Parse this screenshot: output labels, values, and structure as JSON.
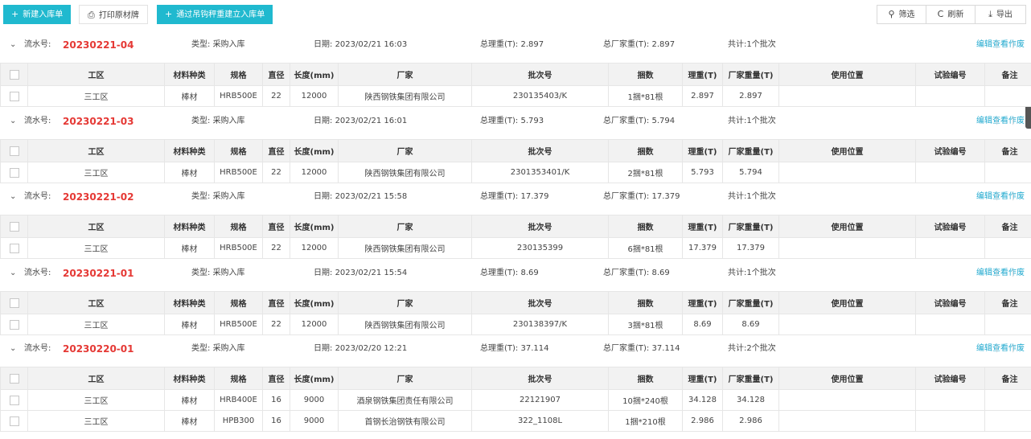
{
  "toolbar": {
    "new_label": "新建入库单",
    "print_label": "打印原材牌",
    "weigh_label": "通过吊钩秤重建立入库单",
    "filter_label": "筛选",
    "refresh_label": "刷新",
    "export_label": "导出"
  },
  "labels": {
    "flow": "流水号:",
    "type": "类型:",
    "date": "日期:",
    "theory_total": "总理重(T):",
    "factory_total": "总厂家重(T):",
    "count": "共计:",
    "edit": "编辑",
    "view": "查看",
    "void": "作废"
  },
  "columns": [
    "",
    "工区",
    "材料种类",
    "规格",
    "直径",
    "长度(mm)",
    "厂家",
    "批次号",
    "捆数",
    "理重(T)",
    "厂家重量(T)",
    "使用位置",
    "试验编号",
    "备注"
  ],
  "groups": [
    {
      "flow_no": "20230221-04",
      "type": "采购入库",
      "date": "2023/02/21 16:03",
      "theory_total": "2.897",
      "factory_total": "2.897",
      "count": "1个批次",
      "rows": [
        {
          "area": "三工区",
          "material": "棒材",
          "spec": "HRB500E",
          "diameter": "22",
          "length": "12000",
          "maker": "陕西钢铁集团有限公司",
          "batch": "230135403/K",
          "bundles": "1捆*81根",
          "theory": "2.897",
          "factory": "2.897",
          "position": "",
          "test_no": "",
          "remark": ""
        }
      ]
    },
    {
      "flow_no": "20230221-03",
      "type": "采购入库",
      "date": "2023/02/21 16:01",
      "theory_total": "5.793",
      "factory_total": "5.794",
      "count": "1个批次",
      "rows": [
        {
          "area": "三工区",
          "material": "棒材",
          "spec": "HRB500E",
          "diameter": "22",
          "length": "12000",
          "maker": "陕西钢铁集团有限公司",
          "batch": "2301353401/K",
          "bundles": "2捆*81根",
          "theory": "5.793",
          "factory": "5.794",
          "position": "",
          "test_no": "",
          "remark": ""
        }
      ]
    },
    {
      "flow_no": "20230221-02",
      "type": "采购入库",
      "date": "2023/02/21 15:58",
      "theory_total": "17.379",
      "factory_total": "17.379",
      "count": "1个批次",
      "rows": [
        {
          "area": "三工区",
          "material": "棒材",
          "spec": "HRB500E",
          "diameter": "22",
          "length": "12000",
          "maker": "陕西钢铁集团有限公司",
          "batch": "230135399",
          "bundles": "6捆*81根",
          "theory": "17.379",
          "factory": "17.379",
          "position": "",
          "test_no": "",
          "remark": ""
        }
      ]
    },
    {
      "flow_no": "20230221-01",
      "type": "采购入库",
      "date": "2023/02/21 15:54",
      "theory_total": "8.69",
      "factory_total": "8.69",
      "count": "1个批次",
      "rows": [
        {
          "area": "三工区",
          "material": "棒材",
          "spec": "HRB500E",
          "diameter": "22",
          "length": "12000",
          "maker": "陕西钢铁集团有限公司",
          "batch": "230138397/K",
          "bundles": "3捆*81根",
          "theory": "8.69",
          "factory": "8.69",
          "position": "",
          "test_no": "",
          "remark": ""
        }
      ]
    },
    {
      "flow_no": "20230220-01",
      "type": "采购入库",
      "date": "2023/02/20 12:21",
      "theory_total": "37.114",
      "factory_total": "37.114",
      "count": "2个批次",
      "rows": [
        {
          "area": "三工区",
          "material": "棒材",
          "spec": "HRB400E",
          "diameter": "16",
          "length": "9000",
          "maker": "酒泉钢铁集团责任有限公司",
          "batch": "22121907",
          "bundles": "10捆*240根",
          "theory": "34.128",
          "factory": "34.128",
          "position": "",
          "test_no": "",
          "remark": ""
        },
        {
          "area": "三工区",
          "material": "棒材",
          "spec": "HPB300",
          "diameter": "16",
          "length": "9000",
          "maker": "首钢长治钢铁有限公司",
          "batch": "322_1108L",
          "bundles": "1捆*210根",
          "theory": "2.986",
          "factory": "2.986",
          "position": "",
          "test_no": "",
          "remark": ""
        }
      ]
    }
  ]
}
